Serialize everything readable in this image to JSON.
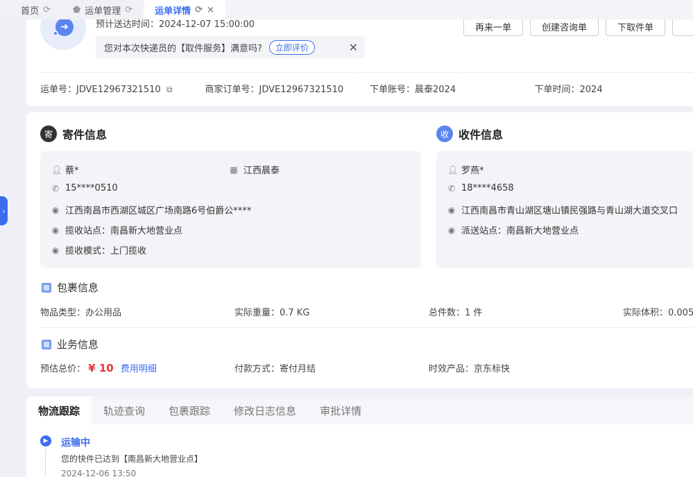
{
  "tabs": [
    {
      "label": "首页",
      "icon": "refresh-icon"
    },
    {
      "label": "运单管理",
      "icon": "refresh-icon"
    },
    {
      "label": "运单详情",
      "icon": "refresh-icon",
      "close": "×"
    }
  ],
  "collapse_arrow": "‹",
  "header": {
    "eta": "预计送达时间：2024-12-07 15:00:00",
    "feedback_text": "您对本次快递员的【取件服务】满意吗?",
    "rate_button": "立即评价",
    "close_symbol": "✕",
    "actions": [
      "再来一单",
      "创建咨询单",
      "下取件单"
    ],
    "waybill_no": "运单号：JDVE12967321510",
    "merchant_order": "商家订单号：JDVE12967321510",
    "account": "下单账号：晨泰2024",
    "order_time": "下单时间：2024"
  },
  "sender": {
    "badge": "寄",
    "title": "寄件信息",
    "name": "蔡*",
    "company": "江西晨泰",
    "phone": "15****0510",
    "address": "江西南昌市西湖区城区广场南路6号伯爵公****",
    "station": "揽收站点：南昌新大地营业点",
    "mode": "揽收模式：上门揽收"
  },
  "receiver": {
    "badge": "收",
    "title": "收件信息",
    "name": "罗燕*",
    "phone": "18****4658",
    "address": "江西南昌市青山湖区塘山镇民强路与青山湖大道交叉口",
    "station": "派送站点：南昌新大地营业点"
  },
  "package": {
    "title": "包裹信息",
    "type": "物品类型：办公用品",
    "weight": "实际重量：0.7 KG",
    "count": "总件数：1 件",
    "volume": "实际体积：0.005"
  },
  "business": {
    "title": "业务信息",
    "price_label": "预估总价：",
    "price_value": "¥ 10",
    "fee_link": "费用明细",
    "payment": "付款方式：寄付月结",
    "product": "时效产品：京东标快"
  },
  "tracking": {
    "tabs": [
      "物流跟踪",
      "轨迹查询",
      "包裹跟踪",
      "修改日志信息",
      "审批详情"
    ],
    "status": "运输中",
    "desc": "您的快件已达到【南昌新大地营业点】",
    "time": "2024-12-06 13:50"
  },
  "colors": {
    "accent": "#3a6df0",
    "price": "#e8343a"
  }
}
